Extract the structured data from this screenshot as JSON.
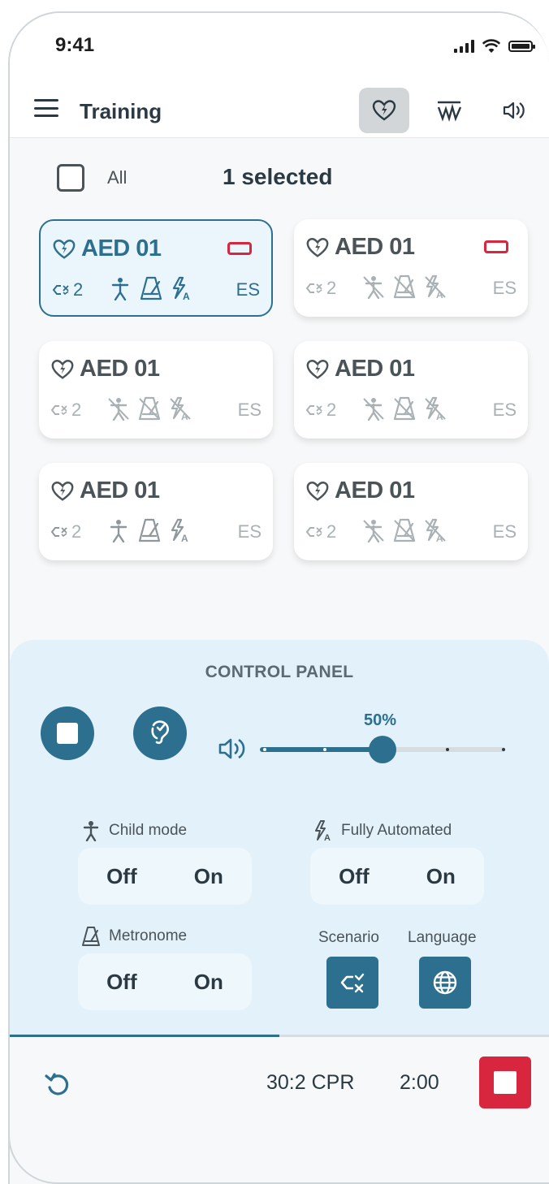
{
  "status_bar": {
    "time": "9:41"
  },
  "header": {
    "title": "Training",
    "buttons": [
      {
        "icon": "aed-heart-icon",
        "active": true
      },
      {
        "icon": "waveform-icon",
        "active": false
      },
      {
        "icon": "speaker-icon",
        "active": false
      }
    ]
  },
  "selection": {
    "all_label": "All",
    "count_label": "1 selected",
    "all_checked": false
  },
  "devices": [
    {
      "name": "AED 01",
      "scenario": "2",
      "language": "ES",
      "selected": true,
      "battery_low": true,
      "child_mode": true,
      "metronome": true,
      "fully_automated": true
    },
    {
      "name": "AED 01",
      "scenario": "2",
      "language": "ES",
      "selected": false,
      "battery_low": true,
      "child_mode": false,
      "metronome": false,
      "fully_automated": false
    },
    {
      "name": "AED 01",
      "scenario": "2",
      "language": "ES",
      "selected": false,
      "battery_low": false,
      "child_mode": false,
      "metronome": false,
      "fully_automated": false
    },
    {
      "name": "AED 01",
      "scenario": "2",
      "language": "ES",
      "selected": false,
      "battery_low": false,
      "child_mode": false,
      "metronome": false,
      "fully_automated": false
    },
    {
      "name": "AED 01",
      "scenario": "2",
      "language": "ES",
      "selected": false,
      "battery_low": false,
      "child_mode": true,
      "metronome": true,
      "fully_automated": true
    },
    {
      "name": "AED 01",
      "scenario": "2",
      "language": "ES",
      "selected": false,
      "battery_low": false,
      "child_mode": false,
      "metronome": false,
      "fully_automated": false
    }
  ],
  "control_panel": {
    "title": "CONTROL PANEL",
    "volume": {
      "label": "50%",
      "value": 0.5
    },
    "child_mode": {
      "label": "Child mode",
      "off": "Off",
      "on": "On"
    },
    "fully_automated": {
      "label": "Fully Automated",
      "off": "Off",
      "on": "On"
    },
    "metronome": {
      "label": "Metronome",
      "off": "Off",
      "on": "On"
    },
    "scenario_label": "Scenario",
    "language_label": "Language"
  },
  "footer": {
    "mode": "30:2 CPR",
    "timer": "2:00",
    "progress": 0.5
  },
  "colors": {
    "accent": "#2d6f8e",
    "alert": "#d7263d",
    "panel_bg": "#e3f2fa"
  }
}
